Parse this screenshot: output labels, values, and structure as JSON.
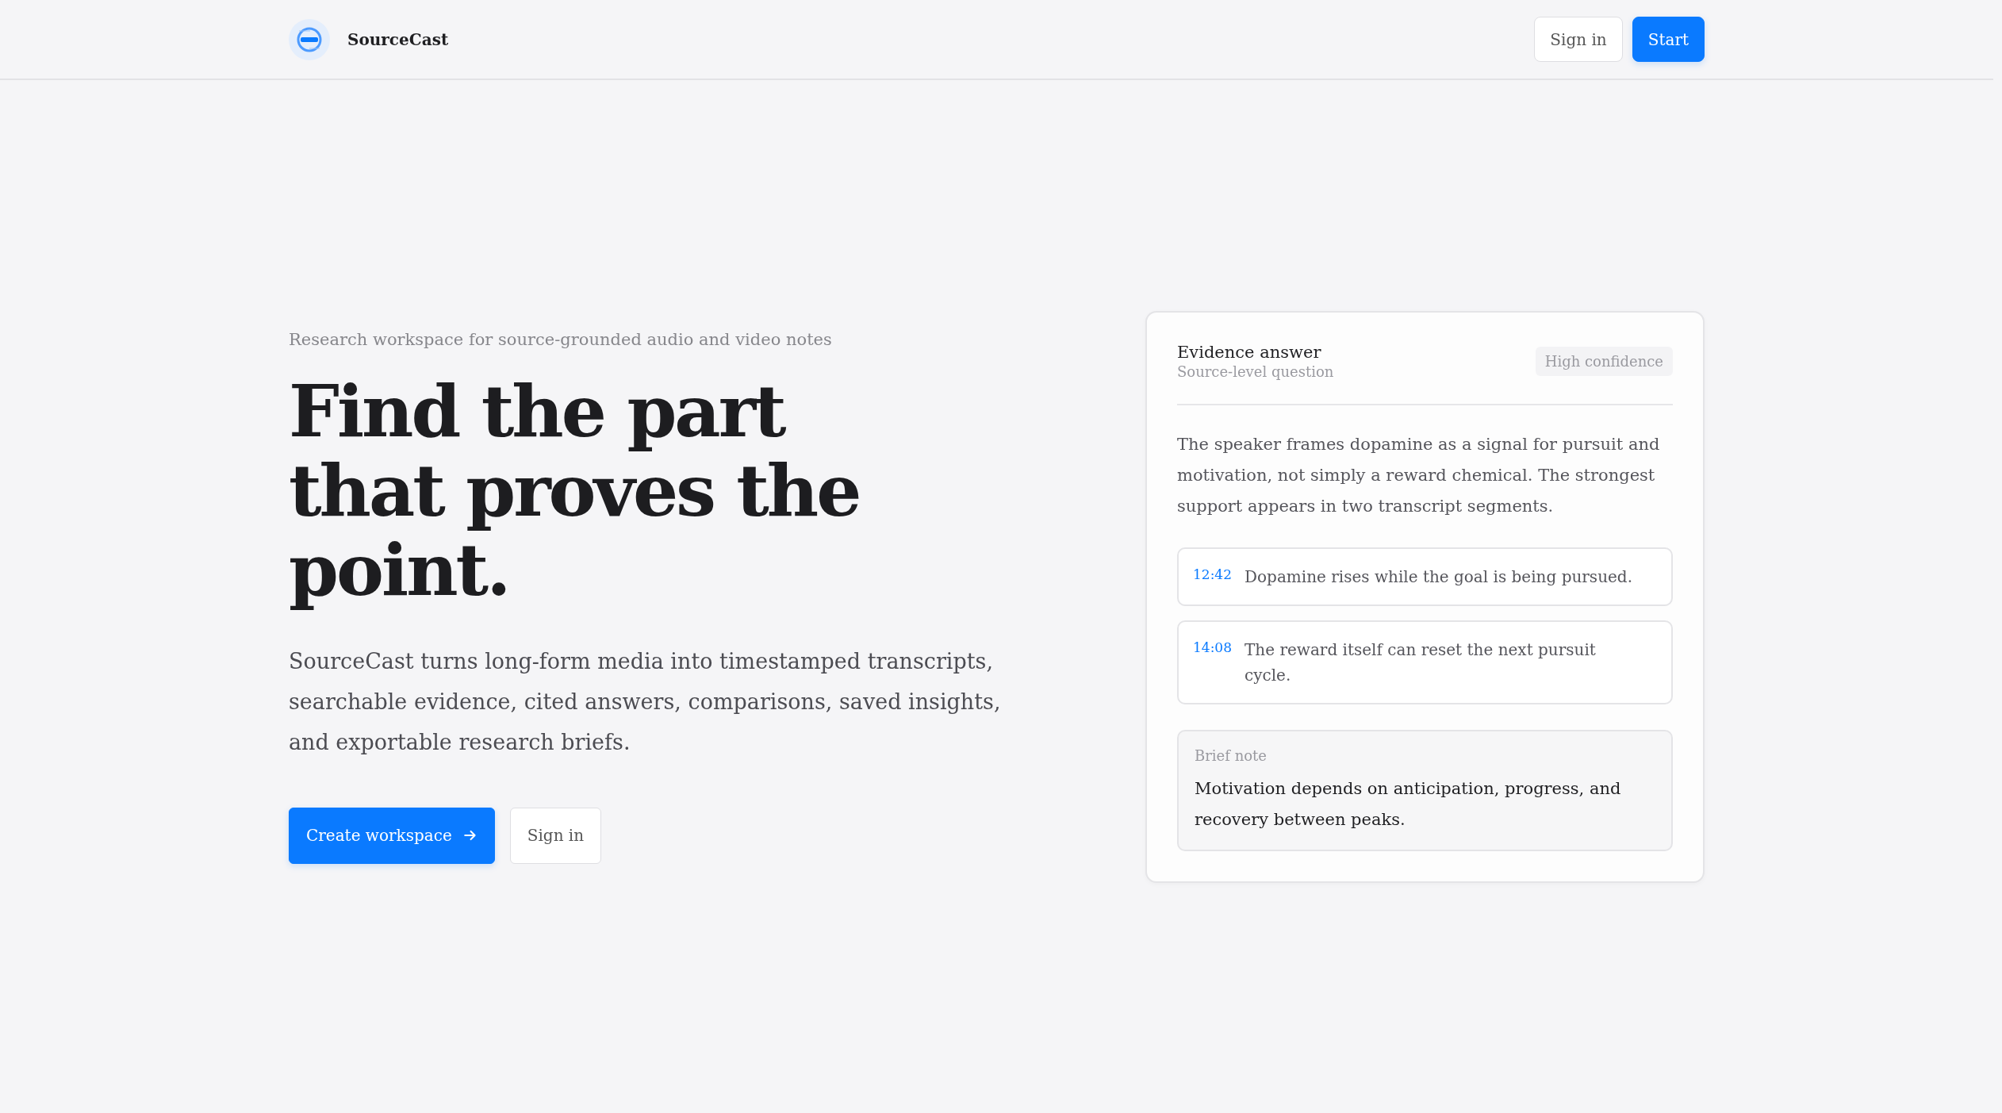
{
  "header": {
    "brand": "SourceCast",
    "buttons": [
      {
        "label": "Sign in",
        "kind": "secondary"
      },
      {
        "label": "Start",
        "kind": "primary"
      }
    ]
  },
  "hero": {
    "eyebrow": "Research workspace for source-grounded audio and video notes",
    "headline": "Find the part that proves the point.",
    "description": "SourceCast turns long-form media into timestamped transcripts, searchable evidence, cited answers, comparisons, saved insights, and exportable research briefs.",
    "buttons": [
      {
        "label": "Create workspace",
        "kind": "primary"
      },
      {
        "label": "Sign in",
        "kind": "secondary"
      }
    ]
  },
  "evidence_card": {
    "title": "Evidence answer",
    "subtitle": "Source-level question",
    "badge": "High confidence",
    "answer": "The speaker frames dopamine as a signal for pursuit and motivation, not simply a reward chemical. The strongest support appears in two transcript segments.",
    "segments": [
      {
        "timestamp": "12:42",
        "text": "Dopamine rises while the goal is being pursued."
      },
      {
        "timestamp": "14:08",
        "text": "The reward itself can reset the next pursuit cycle."
      }
    ],
    "note": {
      "label": "Brief note",
      "text": "Motivation depends on anticipation, progress, and recovery between peaks."
    }
  }
}
